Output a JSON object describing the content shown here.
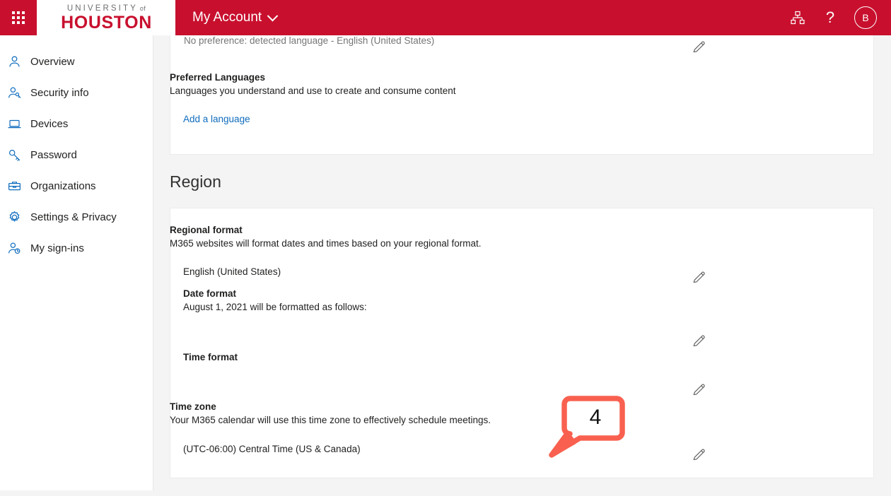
{
  "header": {
    "waffle_icon": "app-launcher-waffle-icon",
    "logo_top": "UNIVERSITY",
    "logo_top_suffix": "of",
    "logo_bottom": "HOUSTON",
    "app_title": "My Account",
    "chevron_icon": "chevron-down-icon",
    "org_icon": "org-hierarchy-icon",
    "help_icon": "help-question-icon",
    "avatar_initial": "B",
    "brand_red": "#c8102e",
    "logo_gray": "#6d6e71"
  },
  "sidebar": {
    "items": [
      {
        "label": "Overview",
        "icon": "person-icon"
      },
      {
        "label": "Security info",
        "icon": "person-key-icon"
      },
      {
        "label": "Devices",
        "icon": "laptop-icon"
      },
      {
        "label": "Password",
        "icon": "key-icon"
      },
      {
        "label": "Organizations",
        "icon": "briefcase-icon"
      },
      {
        "label": "Settings & Privacy",
        "icon": "gear-icon"
      },
      {
        "label": "My sign-ins",
        "icon": "person-clock-icon"
      }
    ],
    "icon_color": "#0f6cbd"
  },
  "language_card": {
    "detected_language": "No preference: detected language - English (United States)",
    "detected_edit_icon": "pencil-edit-icon",
    "preferred_languages_title": "Preferred Languages",
    "preferred_languages_desc": "Languages you understand and use to create and consume content",
    "add_language_link": "Add a language"
  },
  "region_section": {
    "title": "Region",
    "regional_format": {
      "label": "Regional format",
      "desc": "M365 websites will format dates and times based on your regional format.",
      "value": "English (United States)",
      "edit_icon": "pencil-edit-icon"
    },
    "date_format": {
      "label": "Date format",
      "desc": "August 1, 2021 will be formatted as follows:",
      "value": "",
      "edit_icon": "pencil-edit-icon"
    },
    "time_format": {
      "label": "Time format",
      "value": "",
      "edit_icon": "pencil-edit-icon"
    },
    "time_zone": {
      "label": "Time zone",
      "desc": "Your M365 calendar will use this time zone to effectively schedule meetings.",
      "value": "(UTC-06:00) Central Time (US & Canada)",
      "edit_icon": "pencil-edit-icon"
    }
  },
  "annotation": {
    "step_number": "4",
    "color": "#f9604f"
  }
}
